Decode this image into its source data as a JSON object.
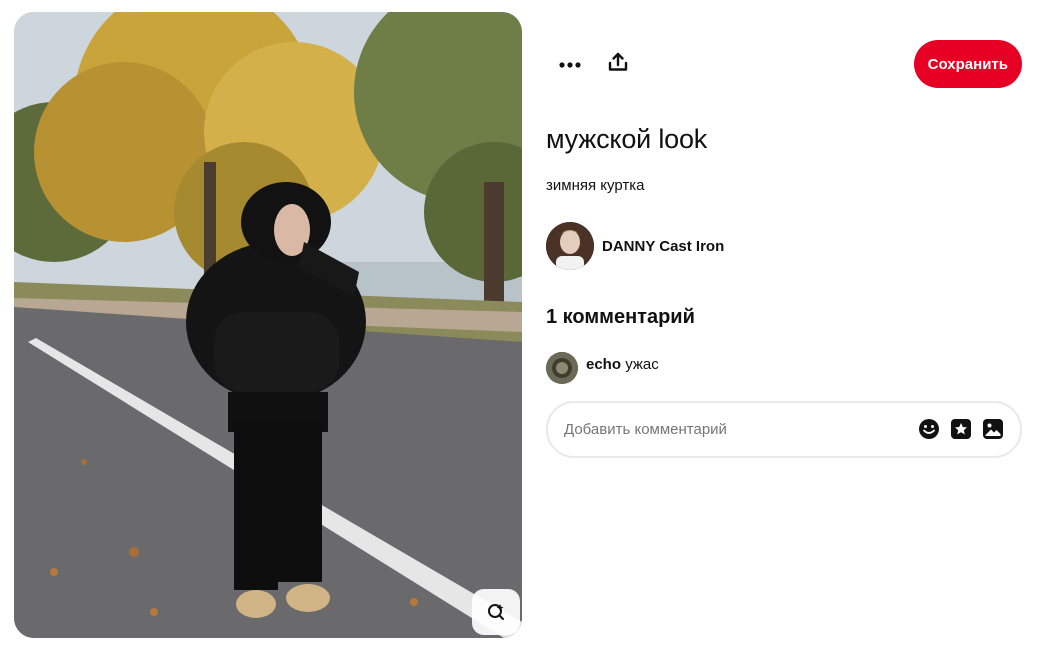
{
  "pin": {
    "title": "мужской look",
    "description": "зимняя куртка",
    "image_icon": "lens-search-icon"
  },
  "toolbar": {
    "more_icon": "more-dots-icon",
    "share_icon": "share-upload-icon",
    "save_label": "Сохранить"
  },
  "author": {
    "name": "DANNY Cast Iron"
  },
  "comments": {
    "heading": "1 комментарий",
    "items": [
      {
        "user": "echo",
        "text": "ужас"
      }
    ],
    "input_placeholder": "Добавить комментарий",
    "icons": [
      "emoji-icon",
      "sticker-icon",
      "image-icon"
    ]
  },
  "colors": {
    "save_button": "#e60023",
    "text": "#111111",
    "placeholder": "#767676",
    "input_border": "#e9e9e9"
  }
}
